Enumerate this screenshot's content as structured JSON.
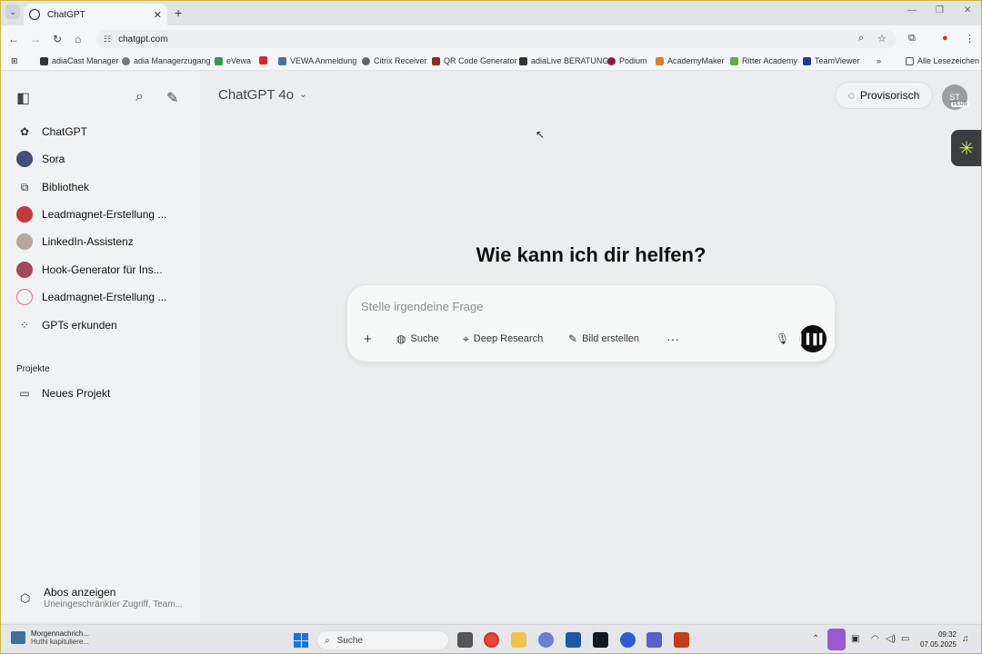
{
  "browser": {
    "tab_title": "ChatGPT",
    "url": "chatgpt.com",
    "bookmarks": [
      "adiaCast Manager",
      "adia Managerzugang",
      "eVewa",
      "",
      "VEWA Anmeldung",
      "Citrix Receiver",
      "QR Code Generator",
      "adiaLive BERATUNG",
      "Podium",
      "AcademyMaker",
      "Ritter Academy",
      "TeamViewer"
    ],
    "all_bookmarks": "Alle Lesezeichen"
  },
  "sidebar": {
    "items": [
      "ChatGPT",
      "Sora",
      "Bibliothek",
      "Leadmagnet-Erstellung ...",
      "LinkedIn-Assistenz",
      "Hook-Generator für Ins...",
      "Leadmagnet-Erstellung ...",
      "GPTs erkunden"
    ],
    "projects_label": "Projekte",
    "new_project": "Neues Projekt",
    "abos_title": "Abos anzeigen",
    "abos_sub": "Uneingeschränkter Zugriff, Team..."
  },
  "main": {
    "model": "ChatGPT 4o",
    "temp_button": "Provisorisch",
    "avatar_initials": "ST",
    "plan_badge": "PLUS",
    "headline": "Wie kann ich dir helfen?",
    "placeholder": "Stelle irgendeine Frage",
    "tools": [
      "Suche",
      "Deep Research",
      "Bild erstellen"
    ]
  },
  "taskbar": {
    "news_title": "Morgennachrich...",
    "news_sub": "Huthi kapituliere...",
    "search": "Suche",
    "time": "09:32",
    "date": "07.05.2025"
  },
  "colors": {
    "accent": "#0e0e0e",
    "widget": "#d6e84a"
  }
}
